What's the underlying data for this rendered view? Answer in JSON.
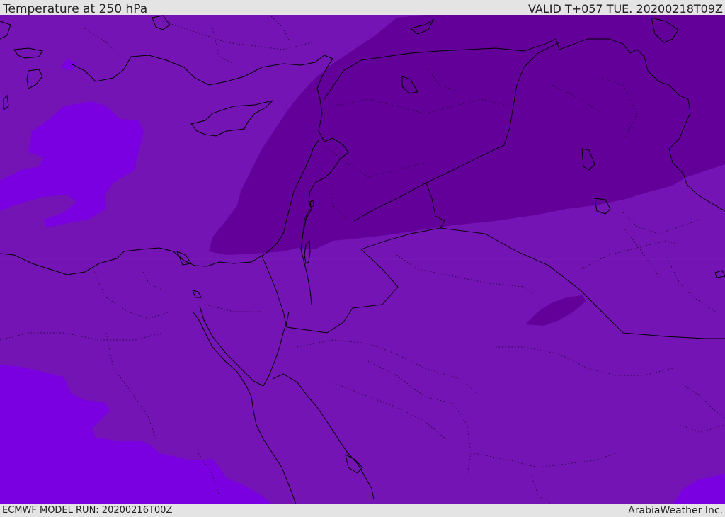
{
  "header": {
    "title": "Temperature at 250 hPa",
    "valid": "VALID T+057 TUE. 20200218T09Z"
  },
  "footer": {
    "model_run": "ECMWF MODEL RUN: 20200216T00Z",
    "credit": "ArabiaWeather Inc."
  },
  "colors": {
    "base_field": "#7414b4",
    "cold_field": "#64009a",
    "warm_field": "#7a00e2",
    "coast_line": "#000000",
    "border_line": "#2a0a3a"
  }
}
